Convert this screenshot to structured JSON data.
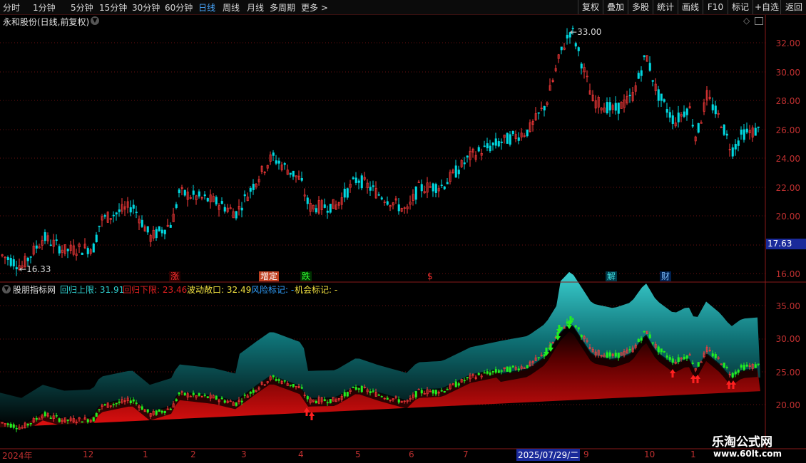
{
  "toolbar": {
    "periods": [
      "分时",
      "1分钟",
      "5分钟",
      "15分钟",
      "30分钟",
      "60分钟",
      "日线",
      "周线",
      "月线",
      "多周期",
      "更多 >"
    ],
    "selected_period": "日线",
    "right_buttons": [
      "复权",
      "叠加",
      "多股",
      "统计",
      "画线",
      "F10",
      "标记",
      "+自选",
      "返回"
    ]
  },
  "main_panel": {
    "title": "永和股份(日线,前复权)",
    "price_axis": [
      "32.00",
      "30.00",
      "28.00",
      "26.00",
      "24.00",
      "22.00",
      "20.00",
      "18.00",
      "16.00"
    ],
    "current_price": "17.63",
    "high_label": "33.00",
    "low_label": "16.33",
    "event_marks": [
      {
        "text": "涨",
        "color": "#ff3030"
      },
      {
        "text": "增定",
        "color": "#ffffff"
      },
      {
        "text": "跌",
        "color": "#30ff30"
      },
      {
        "text": "$",
        "color": "#ff3030"
      },
      {
        "text": "解",
        "color": "#40e0e0"
      },
      {
        "text": "财",
        "color": "#80c0ff"
      }
    ]
  },
  "indicator_panel": {
    "name": "股朋指标网",
    "upper_label": "回归上限: 31.91",
    "lower_label": "回归下限: 23.46",
    "volatility_label": "波动敞口: 32.49",
    "risk_label": "风险标记: -",
    "chance_label": "机会标记: -",
    "axis": [
      "35.00",
      "30.00",
      "25.00",
      "20.00"
    ]
  },
  "x_axis": {
    "labels": [
      "2024年",
      "12",
      "1",
      "2",
      "3",
      "4",
      "5",
      "6",
      "7",
      "2025/07/29/二",
      "9",
      "10",
      "1"
    ]
  },
  "watermark": {
    "line1": "乐淘公式网",
    "line2": "www.60lt.com"
  },
  "colors": {
    "up": "#ff3b3b",
    "down": "#00e0e0",
    "grid": "#7a1010",
    "accent": "#4aa8ff",
    "green_bar": "#22ee22"
  }
}
